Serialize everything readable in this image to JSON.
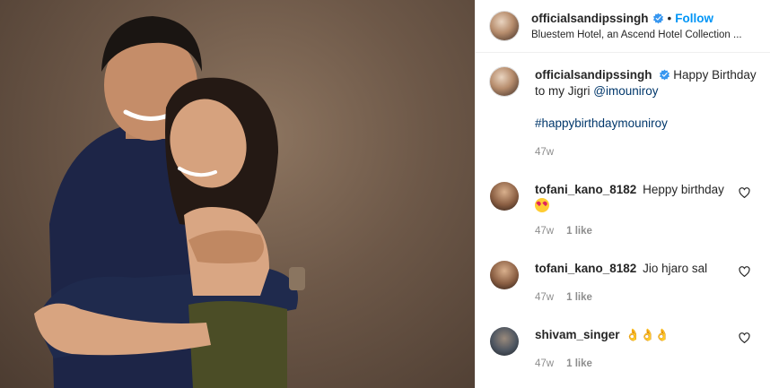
{
  "post": {
    "username": "officialsandipssingh",
    "follow_label": "Follow",
    "separator": "•",
    "location": "Bluestem Hotel, an Ascend Hotel Collection ..."
  },
  "caption": {
    "username": "officialsandipssingh",
    "text": "Happy Birthday to my Jigri",
    "mention": "@imouniroy",
    "hashtag": "#happybirthdaymouniroy",
    "time": "47w"
  },
  "comments": [
    {
      "username": "tofani_kano_8182",
      "text": "Heppy birthday",
      "emoji": "heart-eyes-emoji",
      "time": "47w",
      "likes": "1 like"
    },
    {
      "username": "tofani_kano_8182",
      "text": "Jio hjaro sal",
      "time": "47w",
      "likes": "1 like"
    },
    {
      "username": "shivam_singer",
      "text": "👌👌👌",
      "time": "47w",
      "likes": "1 like"
    }
  ],
  "colors": {
    "link_blue": "#0095f6",
    "mention": "#00376b",
    "muted": "#8e8e8e",
    "border": "#efefef"
  },
  "icons": [
    "verified-badge-icon",
    "heart-outline-icon"
  ]
}
